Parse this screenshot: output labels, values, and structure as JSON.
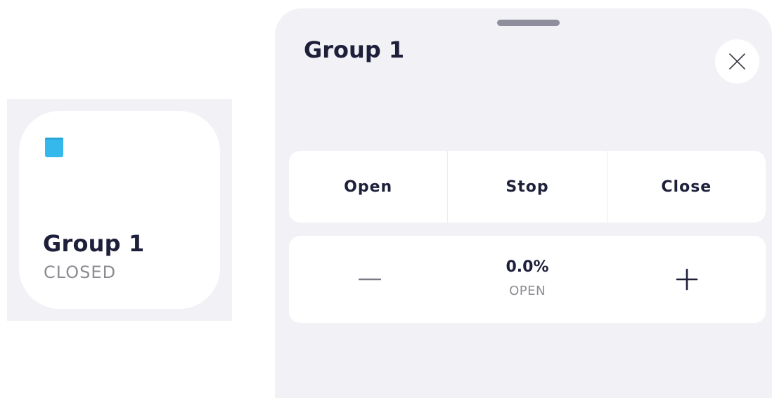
{
  "tile": {
    "name": "Group 1",
    "status": "CLOSED",
    "icon": "blind-icon",
    "icon_color": "#35b8ec"
  },
  "sheet": {
    "title": "Group 1",
    "close_icon": "close-icon",
    "controls": [
      {
        "label": "Open"
      },
      {
        "label": "Stop"
      },
      {
        "label": "Close"
      }
    ],
    "position": {
      "value": "0.0%",
      "label": "OPEN",
      "decrease_icon": "minus-icon",
      "increase_icon": "plus-icon"
    }
  },
  "colors": {
    "background": "#f2f2f6",
    "text": "#1e1f3a",
    "muted": "#8b8b92",
    "card": "#ffffff"
  }
}
